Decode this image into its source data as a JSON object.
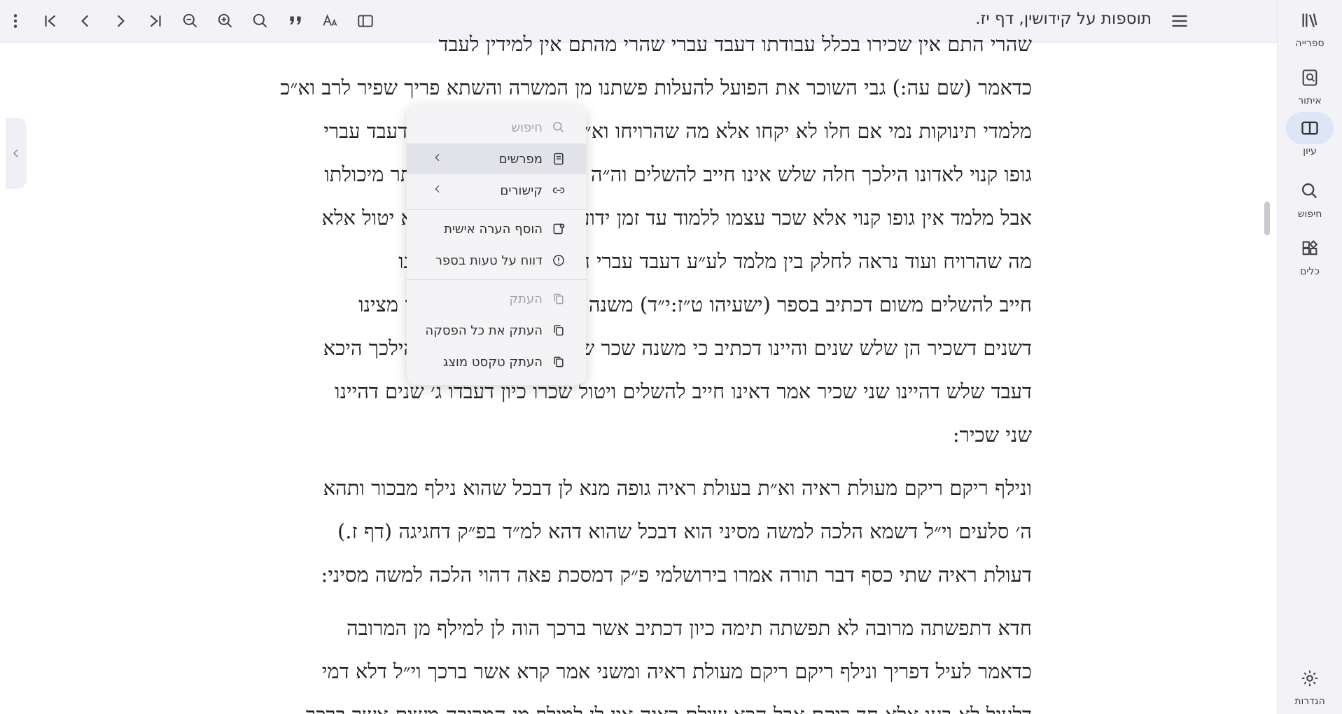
{
  "header": {
    "title": "תוספות על קידושין, דף יז.",
    "tools": [
      "more-vert-icon",
      "first-page-icon",
      "prev-page-icon",
      "next-page-icon",
      "last-page-icon",
      "zoom-out-icon",
      "zoom-in-icon",
      "search-icon",
      "quote-icon",
      "font-icon",
      "sidebar-toggle-icon"
    ]
  },
  "nav": {
    "items": [
      {
        "label": "ספרייה",
        "icon": "library-icon"
      },
      {
        "label": "איתור",
        "icon": "locate-icon"
      },
      {
        "label": "עיון",
        "icon": "book-open-icon",
        "active": true
      },
      {
        "label": "חיפוש",
        "icon": "search-icon"
      },
      {
        "label": "כלים",
        "icon": "tools-icon"
      }
    ],
    "settings_label": "הגדרות"
  },
  "content": {
    "lines": [
      "שהרי התם אין שכירו בכלל עבודתו דעבד עברי שהרי מהתם אין למידין לעבד",
      "כדאמר (שם עה:) גבי השוכר את הפועל להעלות פשתנו מן המשרה והשתא פריך שפיר לרב וא״כ",
      "מלמדי תינוקות נמי אם חלו לא יקחו אלא מה שהרויחו וא״ת ומנא ליה כלל לע״ע דעבד עברי",
      "גופו קנוי לאדונו הילכך חלה שלש אינו חייב להשלים וה״ה שאינו עושה מלאכה יותר מיכולתו",
      "אבל מלמד אין גופו קנוי אלא שכר עצמו ללמוד עד זמן ידוע ולכך חייב להשלים לא יטול אלא",
      "מה שהרויח ועוד נראה לחלק בין מלמד לע״ע דעבד עברי חלה ג׳ היינו טעמא דאינו",
      "חייב להשלים משום דכתיב בספר (ישעיהו ט״ז:י״ד) משנה שכיר דאין שכיר אם כן מצינו",
      "דשנים דשכיר הן שלש שנים והיינו דכתיב כי משנה שכר שכיר עבדך שש שנים והילכך היכא",
      "דעבד שלש דהיינו שני שכיר אמר דאינו חייב להשלים ויטול שכרו כיון דעבדו ג׳ שנים דהיינו",
      "שני שכיר:",
      "ונילף ריקם ריקם מעולת ראיה וא״ת בעולת ראיה גופה מנא לן דבכל שהוא נילף מבכור ותהא",
      "ה׳ סלעים וי״ל דשמא הלכה למשה מסיני הוא דבכל שהוא דהא למ״ד בפ״ק דחגיגה (דף ז.)",
      "דעולת ראיה שתי כסף דבר תורה אמרו בירושלמי פ״ק דמסכת פאה דהוי הלכה למשה מסיני:",
      "חדא דתפשתה מרובה לא תפשתה תימה כיון דכתיב אשר ברכך הוה לן למילף מן המרובה",
      "כדאמר לעיל דפריך ונילף ריקם ריקם מעולת ראיה ומשני אמר קרא אשר ברכך וי״ל דלא דמי",
      "דלעיל לא בעו אלא חד ריקם אבל הכא שולת ראיה אין לן למילף מן המרובה משום אשר ברכך"
    ]
  },
  "context_menu": {
    "search_placeholder": "חיפוש",
    "commentaries": "מפרשים",
    "links": "קישורים",
    "add_note": "הוסף הערה אישית",
    "report_error": "דווח על טעות בספר",
    "copy": "העתק",
    "copy_paragraph": "העתק את כל הפסקה",
    "copy_displayed": "העתק טקסט מוצג"
  }
}
